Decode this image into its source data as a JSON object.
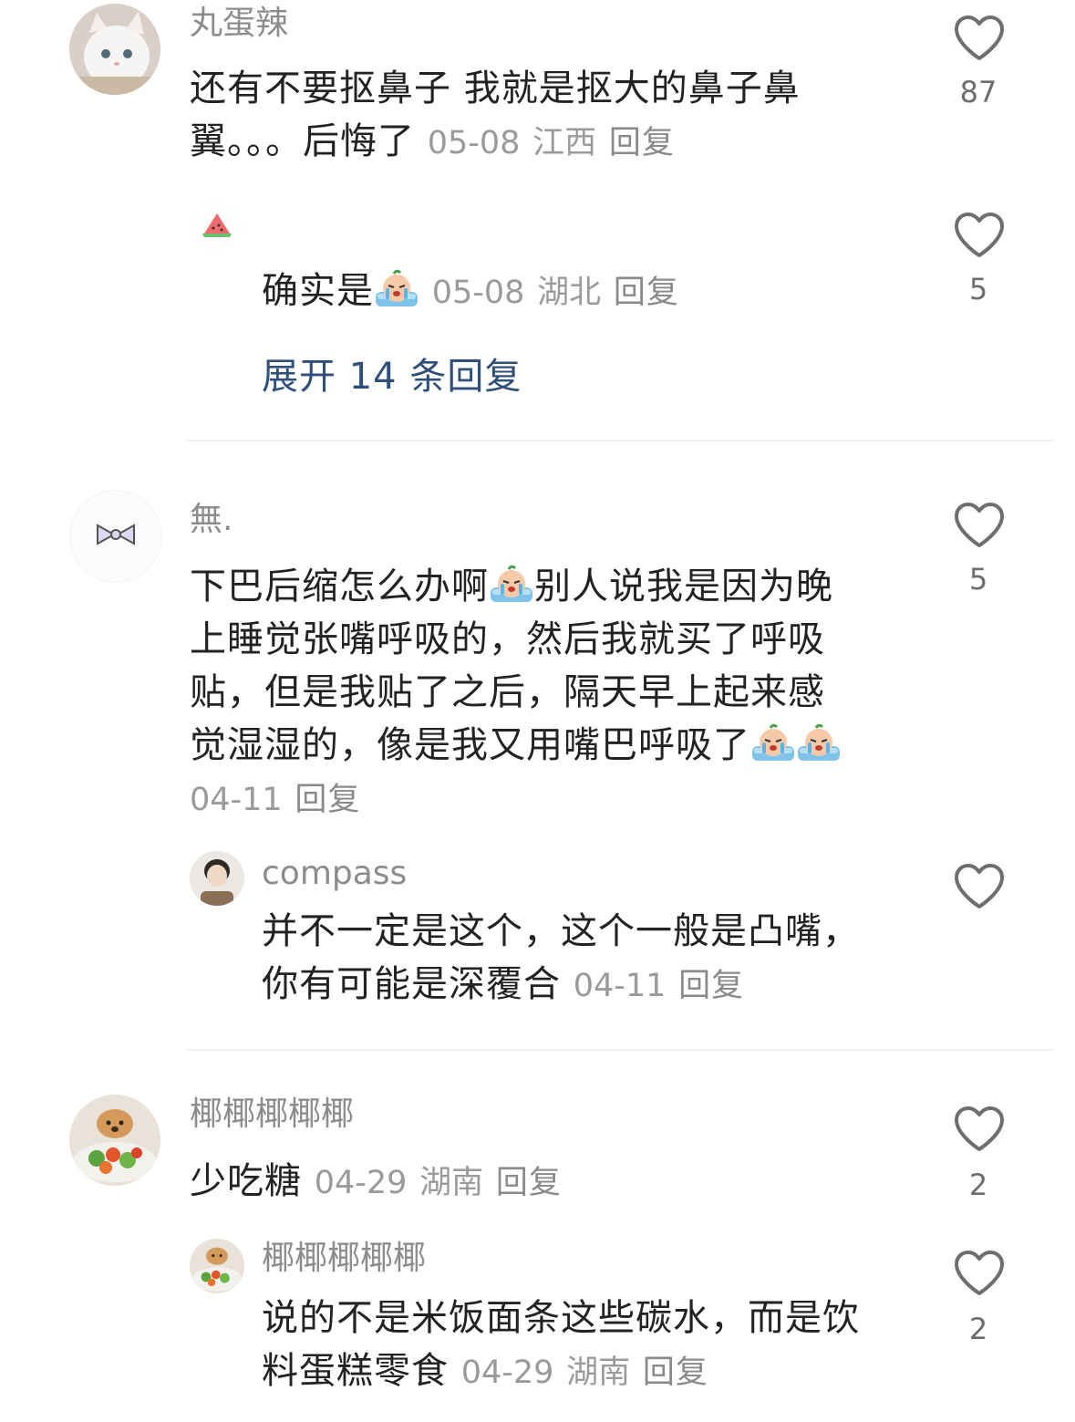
{
  "comments": [
    {
      "username": "丸蛋辣",
      "text_line1": "还有不要抠鼻子 我就是抠大的鼻子鼻",
      "text_line2": "翼。。。后悔了",
      "date": "05-08",
      "location": "江西",
      "reply_label": "回复",
      "likes": "87",
      "avatar_icon": "white-cat-avatar",
      "replies": [
        {
          "username": "",
          "avatar_icon": "watermelon-avatar",
          "text": "确实是",
          "emoji": "crying-emoji",
          "date": "05-08",
          "location": "湖北",
          "reply_label": "回复",
          "likes": "5"
        }
      ],
      "expand_label": "展开 14 条回复"
    },
    {
      "username": "無.",
      "avatar_icon": "bow-avatar",
      "text_line1": "下巴后缩怎么办啊",
      "text_line1b": "别人说我是因为晚",
      "text_line2": "上睡觉张嘴呼吸的，然后我就买了呼吸",
      "text_line3": "贴，但是我贴了之后，隔天早上起来感",
      "text_line4": "觉湿湿的，像是我又用嘴巴呼吸了",
      "date": "04-11",
      "reply_label": "回复",
      "likes": "5",
      "replies": [
        {
          "username": "compass",
          "avatar_icon": "person-avatar",
          "text_line1": "并不一定是这个，这个一般是凸嘴，",
          "text_line2": "你有可能是深覆合",
          "date": "04-11",
          "reply_label": "回复"
        }
      ]
    },
    {
      "username": "椰椰椰椰椰",
      "avatar_icon": "dog-salad-avatar",
      "text": "少吃糖",
      "date": "04-29",
      "location": "湖南",
      "reply_label": "回复",
      "likes": "2",
      "replies": [
        {
          "username": "椰椰椰椰椰",
          "avatar_icon": "dog-salad-avatar",
          "text_line1": "说的不是米饭面条这些碳水，而是饮",
          "text_line2": "料蛋糕零食",
          "date": "04-29",
          "location": "湖南",
          "reply_label": "回复",
          "likes": "2"
        }
      ]
    }
  ],
  "colors": {
    "like_icon": "#7a7a7a",
    "expand_link": "#2f4f7a",
    "meta_text": "#9a9a9a"
  }
}
